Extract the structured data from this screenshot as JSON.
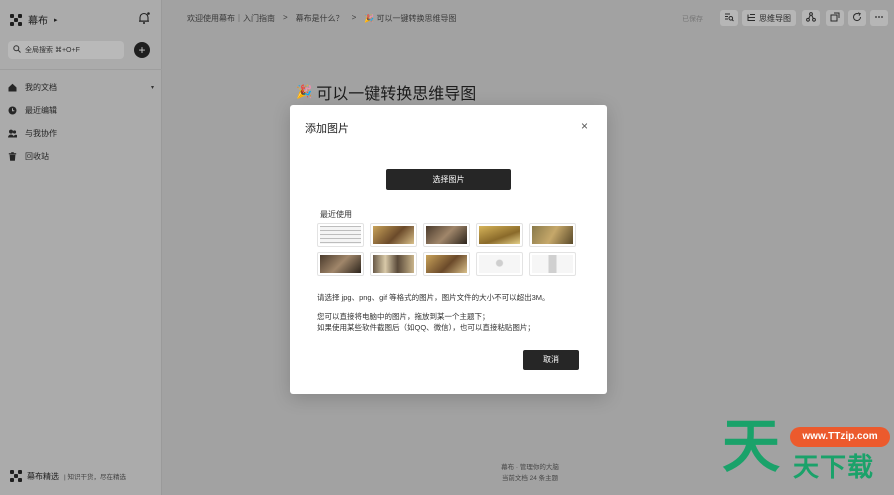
{
  "sidebar": {
    "brand": "幕布",
    "brand_caret": "▸",
    "search_placeholder": "全局搜索 ⌘+O+F",
    "add_label": "+",
    "items": [
      {
        "label": "我的文档",
        "icon": "home-icon"
      },
      {
        "label": "最近编辑",
        "icon": "clock-icon"
      },
      {
        "label": "与我协作",
        "icon": "people-icon"
      },
      {
        "label": "回收站",
        "icon": "trash-icon"
      }
    ],
    "items_caret": "▾",
    "footer_title": "幕布精选",
    "footer_sub": "| 知识干货，尽在精选"
  },
  "topbar": {
    "breadcrumbs": [
      "欢迎使用幕布｜入门指南",
      ">",
      "幕布是什么？",
      ">",
      "🎉 可以一键转换思维导图"
    ],
    "saved": "已保存",
    "mindmap_label": "思维导图"
  },
  "document": {
    "title": "可以一键转换思维导图",
    "title_icon": "🎉",
    "status_line1": "幕布 · 管理你的大脑",
    "status_line2": "当前文档 24 条主题"
  },
  "modal": {
    "title": "添加图片",
    "close": "×",
    "choose_button": "选择图片",
    "recent_label": "最近使用",
    "thumbnails": [
      {
        "kind": "t-doc"
      },
      {
        "kind": "t-warm"
      },
      {
        "kind": "t-dark"
      },
      {
        "kind": "t-gold"
      },
      {
        "kind": "t-olive"
      },
      {
        "kind": "t-dark"
      },
      {
        "kind": "t-people"
      },
      {
        "kind": "t-warm"
      },
      {
        "kind": "t-light"
      },
      {
        "kind": "t-phone"
      }
    ],
    "info_formats": "请选择 jpg、png、gif 等格式的图片，图片文件的大小不可以超出3M。",
    "info_drag_1": "您可以直接将电脑中的图片，拖放到某一个主题下；",
    "info_drag_2": "如果使用某些软件截图后（如QQ、微信），也可以直接粘贴图片；",
    "cancel_button": "取消"
  },
  "watermark": {
    "big": "天",
    "pill": "www.TTzip.com",
    "text": "天下载"
  }
}
